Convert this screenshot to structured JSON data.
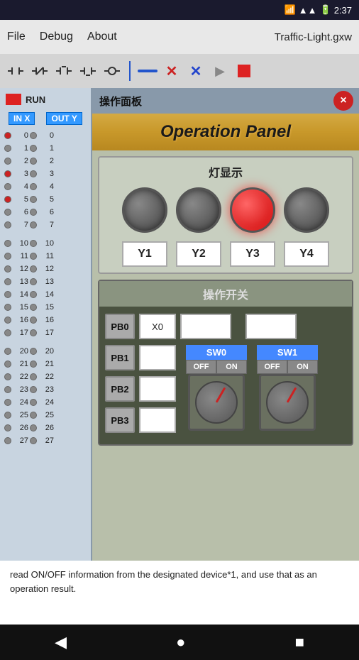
{
  "statusBar": {
    "time": "2:37",
    "battery": "🔋"
  },
  "menuBar": {
    "file": "File",
    "debug": "Debug",
    "about": "About",
    "title": "Traffic-Light.gxw"
  },
  "toolbar": {
    "icons": [
      "contact1",
      "contact2",
      "contact3",
      "contact4",
      "coil"
    ]
  },
  "ioPanel": {
    "headerX": "IN X",
    "headerY": "OUT Y",
    "rows": [
      {
        "num": 0,
        "xActive": true,
        "yActive": false
      },
      {
        "num": 1,
        "xActive": false,
        "yActive": false
      },
      {
        "num": 2,
        "xActive": false,
        "yActive": false
      },
      {
        "num": 3,
        "xActive": true,
        "yActive": false
      },
      {
        "num": 4,
        "xActive": false,
        "yActive": false
      },
      {
        "num": 5,
        "xActive": true,
        "yActive": false
      },
      {
        "num": 6,
        "xActive": false,
        "yActive": false
      },
      {
        "num": 7,
        "xActive": false,
        "yActive": false
      }
    ],
    "rows2": [
      {
        "num": 10,
        "xActive": false,
        "yActive": false
      },
      {
        "num": 11,
        "xActive": false,
        "yActive": false
      },
      {
        "num": 12,
        "xActive": false,
        "yActive": false
      },
      {
        "num": 13,
        "xActive": false,
        "yActive": false
      },
      {
        "num": 14,
        "xActive": false,
        "yActive": false
      },
      {
        "num": 15,
        "xActive": false,
        "yActive": false
      },
      {
        "num": 16,
        "xActive": false,
        "yActive": false
      },
      {
        "num": 17,
        "xActive": false,
        "yActive": false
      }
    ],
    "rows3": [
      {
        "num": 20,
        "xActive": false,
        "yActive": false
      },
      {
        "num": 21,
        "xActive": false,
        "yActive": false
      },
      {
        "num": 22,
        "xActive": false,
        "yActive": false
      },
      {
        "num": 23,
        "xActive": false,
        "yActive": false
      },
      {
        "num": 24,
        "xActive": false,
        "yActive": false
      },
      {
        "num": 25,
        "xActive": false,
        "yActive": false
      },
      {
        "num": 26,
        "xActive": false,
        "yActive": false
      },
      {
        "num": 27,
        "xActive": false,
        "yActive": false
      }
    ]
  },
  "panelTitlebar": {
    "title": "操作面板",
    "closeLabel": "×"
  },
  "opPanel": {
    "header": "Operation Panel",
    "lightSection": {
      "title": "灯显示",
      "lights": [
        {
          "id": "L1",
          "active": false
        },
        {
          "id": "L2",
          "active": false
        },
        {
          "id": "L3",
          "active": true
        },
        {
          "id": "L4",
          "active": false
        }
      ],
      "labels": [
        "Y1",
        "Y2",
        "Y3",
        "Y4"
      ]
    },
    "switchSection": {
      "title": "操作开关",
      "pb0": "PB0",
      "pb1": "PB1",
      "pb2": "PB2",
      "pb3": "PB3",
      "x0": "X0",
      "sw0": "SW0",
      "sw1": "SW1",
      "off": "OFF",
      "on": "ON"
    }
  },
  "bottomText": "read ON/OFF information from the designated device*1, and use that as an operation result.",
  "runLabel": "RUN",
  "navBar": {
    "back": "◀",
    "home": "●",
    "recent": "■"
  }
}
